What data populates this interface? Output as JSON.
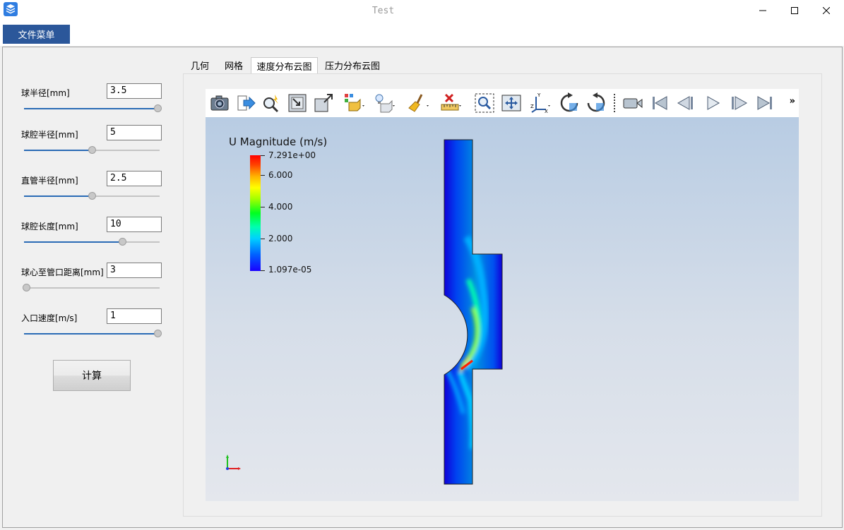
{
  "window": {
    "title": "Test",
    "controls": [
      "minimize-icon",
      "maximize-icon",
      "close-icon"
    ]
  },
  "menu": {
    "file_label": "文件菜单"
  },
  "params": [
    {
      "label": "球半径[mm]",
      "value": "3.5",
      "slider_fraction": 1.0
    },
    {
      "label": "球腔半径[mm]",
      "value": "5",
      "slider_fraction": 0.5
    },
    {
      "label": "直管半径[mm]",
      "value": "2.5",
      "slider_fraction": 0.5
    },
    {
      "label": "球腔长度[mm]",
      "value": "10",
      "slider_fraction": 0.73
    },
    {
      "label": "球心至管口距离[mm]",
      "value": "3",
      "slider_fraction": 0.0
    },
    {
      "label": "入口速度[m/s]",
      "value": "1",
      "slider_fraction": 1.0
    }
  ],
  "calc_button": "计算",
  "tabs": [
    {
      "label": "几何",
      "active": false
    },
    {
      "label": "网格",
      "active": false
    },
    {
      "label": "速度分布云图",
      "active": true
    },
    {
      "label": "压力分布云图",
      "active": false
    }
  ],
  "toolbar": {
    "icons": [
      "camera-icon",
      "save-state-icon",
      "zoom-magic-icon",
      "reset-camera-icon",
      "zoom-to-box-icon",
      "representation-icon",
      "light-icon",
      "clear-brush-icon",
      "ruler-delete-icon",
      "zoom-selection-icon",
      "fit-all-icon",
      "axes-icon",
      "rotate-cw-icon",
      "rotate-ccw-icon",
      "camera-record-icon",
      "first-frame-icon",
      "previous-frame-icon",
      "play-icon",
      "next-frame-icon",
      "last-frame-icon"
    ],
    "more": "»"
  },
  "colorbar": {
    "title": "U Magnitude (m/s)",
    "labels": [
      "7.291e+00",
      "6.000",
      "4.000",
      "2.000",
      "1.097e-05"
    ],
    "max": 7.291,
    "min": 1.097e-05
  },
  "colors": {
    "accent": "#2b579a",
    "slider_fill": "#2a6bb5"
  }
}
